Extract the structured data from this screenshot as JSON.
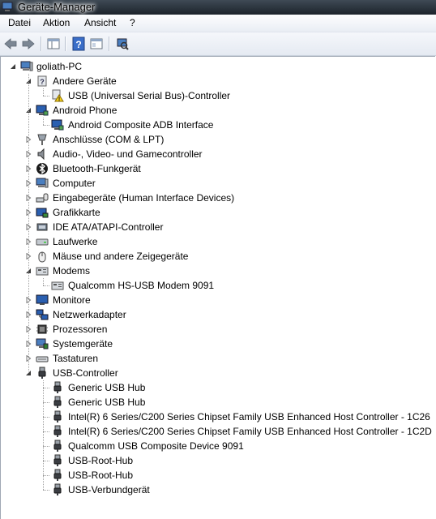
{
  "window": {
    "title": "Geräte-Manager"
  },
  "menu": [
    "Datei",
    "Aktion",
    "Ansicht",
    "?"
  ],
  "toolbar": [
    {
      "name": "back-button",
      "icon": "arrow-left-icon"
    },
    {
      "name": "forward-button",
      "icon": "arrow-right-icon"
    },
    {
      "name": "show-hide-console-tree-button",
      "icon": "console-tree-icon"
    },
    {
      "name": "help-button",
      "icon": "help-icon"
    },
    {
      "name": "properties-button",
      "icon": "properties-icon"
    },
    {
      "name": "scan-hardware-button",
      "icon": "scan-hardware-icon"
    }
  ],
  "tree": {
    "root": "goliath-PC",
    "items": [
      {
        "label": "Andere Geräte",
        "level": 1,
        "expanded": true,
        "icon": "unknown-device-icon"
      },
      {
        "label": "USB (Universal Serial Bus)-Controller",
        "level": 2,
        "icon": "warning-device-icon"
      },
      {
        "label": "Android Phone",
        "level": 1,
        "expanded": true,
        "icon": "monitor-device-icon"
      },
      {
        "label": "Android Composite ADB Interface",
        "level": 2,
        "icon": "monitor-device-icon"
      },
      {
        "label": "Anschlüsse (COM & LPT)",
        "level": 1,
        "expanded": false,
        "icon": "port-icon"
      },
      {
        "label": "Audio-, Video- und Gamecontroller",
        "level": 1,
        "expanded": false,
        "icon": "speaker-icon"
      },
      {
        "label": "Bluetooth-Funkgerät",
        "level": 1,
        "expanded": false,
        "icon": "bluetooth-icon"
      },
      {
        "label": "Computer",
        "level": 1,
        "expanded": false,
        "icon": "computer-icon"
      },
      {
        "label": "Eingabegeräte (Human Interface Devices)",
        "level": 1,
        "expanded": false,
        "icon": "input-device-icon"
      },
      {
        "label": "Grafikkarte",
        "level": 1,
        "expanded": false,
        "icon": "display-adapter-icon"
      },
      {
        "label": "IDE ATA/ATAPI-Controller",
        "level": 1,
        "expanded": false,
        "icon": "ide-controller-icon"
      },
      {
        "label": "Laufwerke",
        "level": 1,
        "expanded": false,
        "icon": "drive-icon"
      },
      {
        "label": "Mäuse und andere Zeigegeräte",
        "level": 1,
        "expanded": false,
        "icon": "mouse-icon"
      },
      {
        "label": "Modems",
        "level": 1,
        "expanded": true,
        "icon": "modem-icon"
      },
      {
        "label": "Qualcomm HS-USB Modem 9091",
        "level": 2,
        "icon": "modem-icon"
      },
      {
        "label": "Monitore",
        "level": 1,
        "expanded": false,
        "icon": "monitor-icon"
      },
      {
        "label": "Netzwerkadapter",
        "level": 1,
        "expanded": false,
        "icon": "network-adapter-icon"
      },
      {
        "label": "Prozessoren",
        "level": 1,
        "expanded": false,
        "icon": "processor-icon"
      },
      {
        "label": "Systemgeräte",
        "level": 1,
        "expanded": false,
        "icon": "system-device-icon"
      },
      {
        "label": "Tastaturen",
        "level": 1,
        "expanded": false,
        "icon": "keyboard-icon"
      },
      {
        "label": "USB-Controller",
        "level": 1,
        "expanded": true,
        "icon": "usb-plug-icon"
      },
      {
        "label": "Generic USB Hub",
        "level": 2,
        "icon": "usb-plug-icon"
      },
      {
        "label": "Generic USB Hub",
        "level": 2,
        "icon": "usb-plug-icon"
      },
      {
        "label": "Intel(R) 6 Series/C200 Series Chipset Family USB Enhanced Host Controller - 1C26",
        "level": 2,
        "icon": "usb-plug-icon"
      },
      {
        "label": "Intel(R) 6 Series/C200 Series Chipset Family USB Enhanced Host Controller - 1C2D",
        "level": 2,
        "icon": "usb-plug-icon"
      },
      {
        "label": "Qualcomm USB Composite Device 9091",
        "level": 2,
        "icon": "usb-plug-icon"
      },
      {
        "label": "USB-Root-Hub",
        "level": 2,
        "icon": "usb-plug-icon"
      },
      {
        "label": "USB-Root-Hub",
        "level": 2,
        "icon": "usb-plug-icon"
      },
      {
        "label": "USB-Verbundgerät",
        "level": 2,
        "icon": "usb-plug-icon"
      }
    ]
  }
}
